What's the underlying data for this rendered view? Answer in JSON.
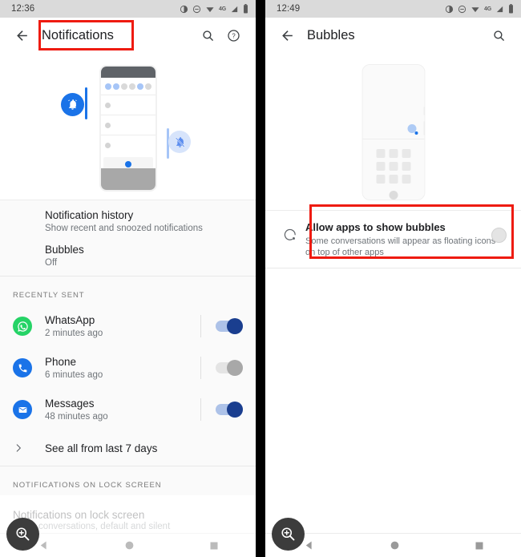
{
  "left_phone": {
    "status_bar": {
      "time": "12:36",
      "icons": [
        "contrast-icon",
        "dnd-icon",
        "wifi-icon",
        "4g-label",
        "signal-icon",
        "battery-icon"
      ],
      "network_label": "4G"
    },
    "app_bar": {
      "back_icon": "back-arrow-icon",
      "title": "Notifications",
      "search_icon": "search-icon",
      "help_icon": "help-icon"
    },
    "illustration": "notifications-hero-illustration",
    "items": [
      {
        "title": "Notification history",
        "subtitle": "Show recent and snoozed notifications"
      },
      {
        "title": "Bubbles",
        "subtitle": "Off"
      }
    ],
    "recently_sent_header": "Recently sent",
    "apps": [
      {
        "name": "WhatsApp",
        "time": "2 minutes ago",
        "icon": "whatsapp-icon",
        "color": "#25D366",
        "toggle": "on"
      },
      {
        "name": "Phone",
        "time": "6 minutes ago",
        "icon": "phone-icon",
        "color": "#1a73e8",
        "toggle": "off"
      },
      {
        "name": "Messages",
        "time": "48 minutes ago",
        "icon": "messages-icon",
        "color": "#1a73e8",
        "toggle": "on"
      }
    ],
    "see_all": "See all from last 7 days",
    "lock_screen_header": "Notifications on lock screen",
    "lock_screen_item": {
      "title": "Notifications on lock screen",
      "subtitle": "Show conversations, default and silent"
    },
    "zoom_button": "zoom-in-icon",
    "nav": [
      "back-nav-icon",
      "home-nav-icon",
      "recents-nav-icon"
    ]
  },
  "right_phone": {
    "status_bar": {
      "time": "12:49",
      "icons": [
        "contrast-icon",
        "dnd-icon",
        "wifi-icon",
        "4g-label",
        "signal-icon",
        "battery-icon"
      ],
      "network_label": "4G"
    },
    "app_bar": {
      "back_icon": "back-arrow-icon",
      "title": "Bubbles",
      "search_icon": "search-icon"
    },
    "illustration": "bubbles-hero-illustration",
    "bubble_setting": {
      "icon": "bubble-icon",
      "title": "Allow apps to show bubbles",
      "subtitle": "Some conversations will appear as floating icons on top of other apps",
      "toggle": "off"
    },
    "zoom_button": "zoom-in-icon",
    "nav": [
      "back-nav-icon",
      "home-nav-icon",
      "recents-nav-icon"
    ]
  },
  "annotations": {
    "highlight_color": "#EE1B11",
    "boxes": [
      "notifications-title-highlight",
      "allow-bubbles-row-highlight"
    ]
  }
}
